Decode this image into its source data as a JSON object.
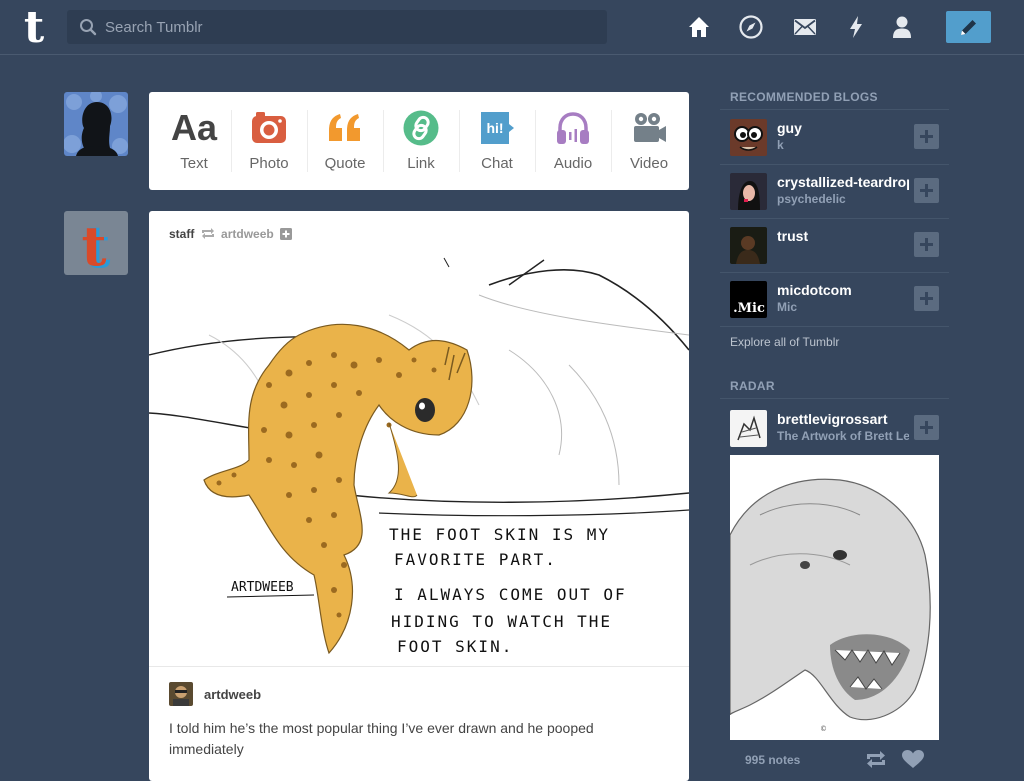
{
  "header": {
    "logo_letter": "t",
    "search_placeholder": "Search Tumblr",
    "icons": [
      "home-icon",
      "explore-icon",
      "inbox-icon",
      "activity-icon",
      "account-icon",
      "compose-icon"
    ],
    "accent_color": "#529ecc",
    "background_color": "#36465d"
  },
  "post_types": [
    {
      "label": "Text",
      "glyph": "Aa",
      "color": "#444444"
    },
    {
      "label": "Photo",
      "color": "#d95e40"
    },
    {
      "label": "Quote",
      "color": "#f2992e"
    },
    {
      "label": "Link",
      "color": "#56bc8a"
    },
    {
      "label": "Chat",
      "glyph": "hi!",
      "color": "#529ecc"
    },
    {
      "label": "Audio",
      "color": "#a77dc2"
    },
    {
      "label": "Video",
      "color": "#748089"
    }
  ],
  "post": {
    "blog": "staff",
    "reblogged_from": "artdweeb",
    "image_caption_lines": [
      "THE FOOT SKIN IS MY",
      "FAVORITE PART.",
      "I ALWAYS COME OUT OF",
      "HIDING TO WATCH THE",
      "FOOT SKIN."
    ],
    "image_signature": "ARTDWEEB",
    "author": "artdweeb",
    "body": "I told him he’s the most popular thing I’ve ever drawn and he pooped immediately"
  },
  "sidebar": {
    "recommended_title": "RECOMMENDED BLOGS",
    "recommended": [
      {
        "name": "guy",
        "subtitle": "k"
      },
      {
        "name": "crystallized-teardrops",
        "subtitle": "psychedelic"
      },
      {
        "name": "trust",
        "subtitle": ""
      },
      {
        "name": "micdotcom",
        "subtitle": "Mic",
        "avatar_text": ".Mic"
      }
    ],
    "explore_link": "Explore all of Tumblr",
    "radar_title": "RADAR",
    "radar": {
      "name": "brettlevigrossart",
      "subtitle": "The Artwork of Brett Levi Gross",
      "notes": "995 notes"
    }
  }
}
